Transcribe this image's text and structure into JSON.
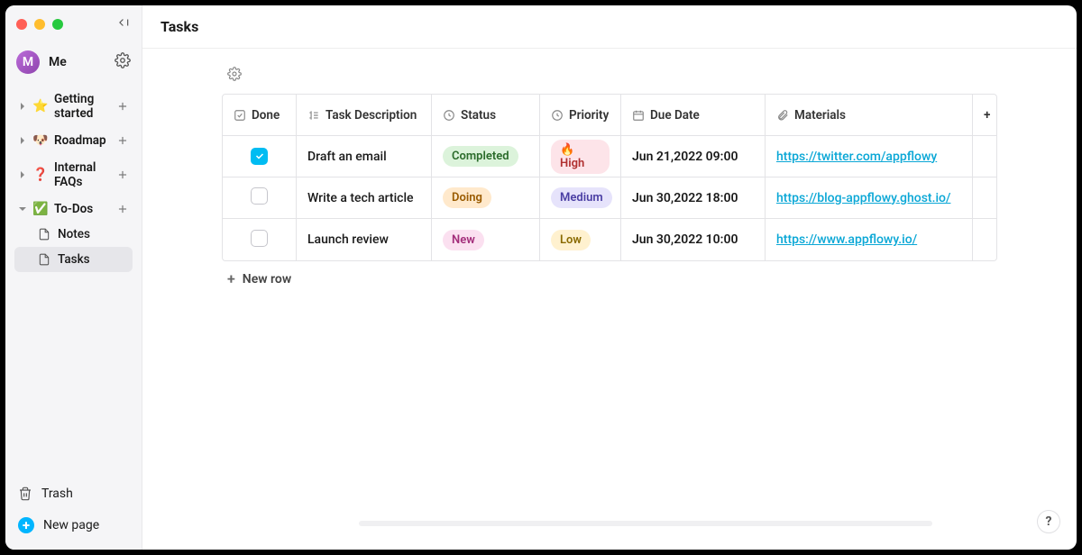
{
  "user": {
    "initial": "M",
    "name": "Me"
  },
  "sidebar": {
    "items": [
      {
        "emoji": "⭐",
        "label": "Getting started"
      },
      {
        "emoji": "🐶",
        "label": "Roadmap"
      },
      {
        "emoji": "❓",
        "label": "Internal FAQs"
      },
      {
        "emoji": "✅",
        "label": "To-Dos",
        "children": [
          {
            "label": "Notes"
          },
          {
            "label": "Tasks"
          }
        ]
      }
    ],
    "trash_label": "Trash",
    "newpage_label": "New page"
  },
  "page": {
    "title": "Tasks"
  },
  "table": {
    "columns": {
      "done": "Done",
      "desc": "Task Description",
      "status": "Status",
      "priority": "Priority",
      "date": "Due Date",
      "materials": "Materials"
    },
    "rows": [
      {
        "done": true,
        "desc": "Draft an email",
        "status": {
          "label": "Completed",
          "class": "badge-completed"
        },
        "priority": {
          "label": "🔥 High",
          "class": "badge-high"
        },
        "date": "Jun 21,2022  09:00",
        "materials": "https://twitter.com/appflowy"
      },
      {
        "done": false,
        "desc": "Write a tech article",
        "status": {
          "label": "Doing",
          "class": "badge-doing"
        },
        "priority": {
          "label": "Medium",
          "class": "badge-medium"
        },
        "date": "Jun 30,2022  18:00",
        "materials": "https://blog-appflowy.ghost.io/"
      },
      {
        "done": false,
        "desc": "Launch review",
        "status": {
          "label": "New",
          "class": "badge-new"
        },
        "priority": {
          "label": "Low",
          "class": "badge-low"
        },
        "date": "Jun 30,2022  10:00",
        "materials": "https://www.appflowy.io/"
      }
    ],
    "new_row_label": "New row"
  },
  "help_label": "?"
}
